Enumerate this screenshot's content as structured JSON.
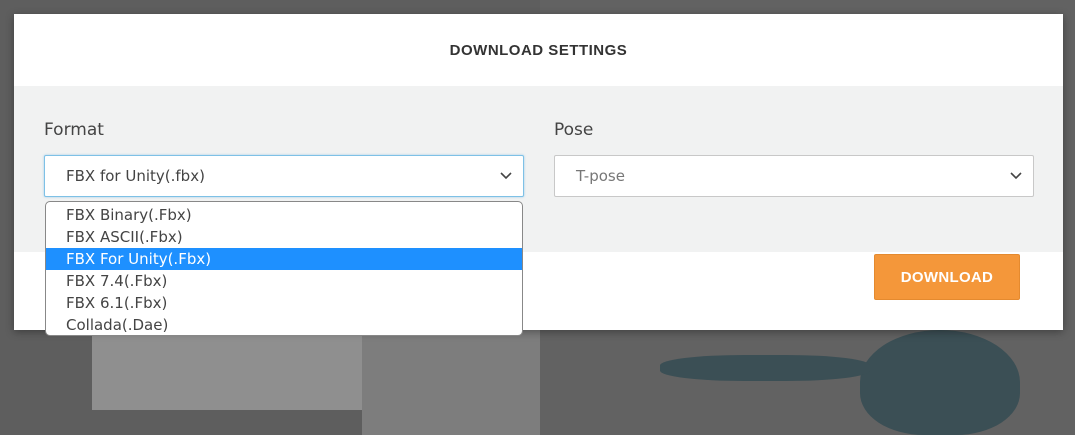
{
  "dialog": {
    "title": "DOWNLOAD SETTINGS",
    "download_label": "DOWNLOAD"
  },
  "format": {
    "label": "Format",
    "selected": "FBX for Unity(.fbx)",
    "options": [
      "FBX Binary(.Fbx)",
      "FBX ASCII(.Fbx)",
      "FBX For Unity(.Fbx)",
      "FBX 7.4(.Fbx)",
      "FBX 6.1(.Fbx)",
      "Collada(.Dae)"
    ],
    "highlighted_index": 2
  },
  "pose": {
    "label": "Pose",
    "selected": "T-pose"
  },
  "colors": {
    "accent": "#f4973a",
    "highlight": "#1e90ff",
    "focus_border": "#7ec1e6"
  }
}
